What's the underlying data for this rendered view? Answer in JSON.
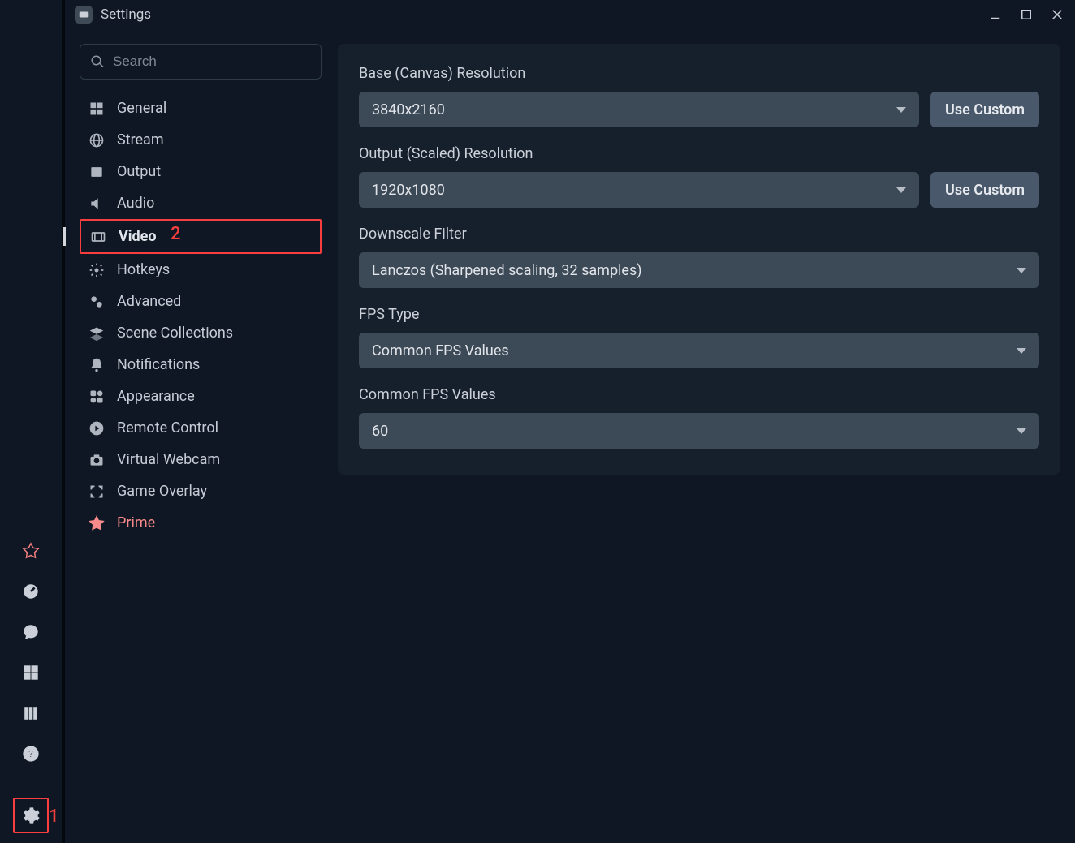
{
  "window": {
    "title": "Settings"
  },
  "search": {
    "placeholder": "Search"
  },
  "sidebar": {
    "items": [
      {
        "id": "general",
        "label": "General"
      },
      {
        "id": "stream",
        "label": "Stream"
      },
      {
        "id": "output",
        "label": "Output"
      },
      {
        "id": "audio",
        "label": "Audio"
      },
      {
        "id": "video",
        "label": "Video"
      },
      {
        "id": "hotkeys",
        "label": "Hotkeys"
      },
      {
        "id": "advanced",
        "label": "Advanced"
      },
      {
        "id": "scene-collections",
        "label": "Scene Collections"
      },
      {
        "id": "notifications",
        "label": "Notifications"
      },
      {
        "id": "appearance",
        "label": "Appearance"
      },
      {
        "id": "remote-control",
        "label": "Remote Control"
      },
      {
        "id": "virtual-webcam",
        "label": "Virtual Webcam"
      },
      {
        "id": "game-overlay",
        "label": "Game Overlay"
      },
      {
        "id": "prime",
        "label": "Prime"
      }
    ]
  },
  "video": {
    "base_label": "Base (Canvas) Resolution",
    "base_value": "3840x2160",
    "base_custom_btn": "Use Custom",
    "output_label": "Output (Scaled) Resolution",
    "output_value": "1920x1080",
    "output_custom_btn": "Use Custom",
    "filter_label": "Downscale Filter",
    "filter_value": "Lanczos (Sharpened scaling, 32 samples)",
    "fps_type_label": "FPS Type",
    "fps_type_value": "Common FPS Values",
    "fps_label": "Common FPS Values",
    "fps_value": "60"
  },
  "annotations": {
    "gear": "1",
    "video": "2"
  }
}
